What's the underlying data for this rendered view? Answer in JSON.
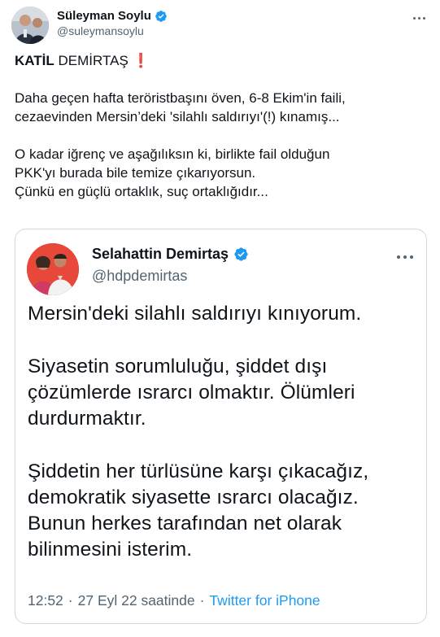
{
  "author": {
    "display_name": "Süleyman Soylu",
    "handle": "@suleymansoylu",
    "verified": true
  },
  "tweet": {
    "headline_bold": "KATİL",
    "headline_rest": " DEMİRTAŞ",
    "headline_emoji": "❗",
    "paragraphs": [
      [
        "Daha geçen hafta teröristbaşını öven, 6-8 Ekim'in faili,",
        "cezaevinden Mersin’deki 'silahlı saldırıyı'(!) kınamış..."
      ],
      [
        "O kadar iğrenç ve aşağılıksın ki, birlikte fail olduğun",
        "PKK'yı burada bile temize çıkarıyorsun.",
        "Çünkü en güçlü ortaklık, suç ortaklığıdır..."
      ]
    ]
  },
  "quoted": {
    "display_name": "Selahattin Demirtaş",
    "handle": "@hdpdemirtas",
    "verified": true,
    "paragraphs": [
      [
        "Mersin'deki silahlı saldırıyı kınıyorum."
      ],
      [
        "Siyasetin sorumluluğu, şiddet dışı",
        "çözümlerde ısrarcı olmaktır. Ölümleri",
        "durdurmaktır."
      ],
      [
        "Şiddetin her türlüsüne karşı çıkacağız,",
        "demokratik siyasette ısrarcı olacağız.",
        "Bunun herkes tarafından net olarak",
        "bilinmesini isterim."
      ]
    ],
    "time": "12:52",
    "separator": "·",
    "date": "27 Eyl 22 saatinde",
    "source": "Twitter for iPhone"
  },
  "colors": {
    "verified_blue": "#1d9bf0",
    "text": "#0f1419",
    "secondary": "#536471",
    "exclaim_red": "#d9253a",
    "border": "#cfd9de"
  },
  "icons": {
    "verified": "verified-badge-icon",
    "more": "more-dots-icon"
  }
}
